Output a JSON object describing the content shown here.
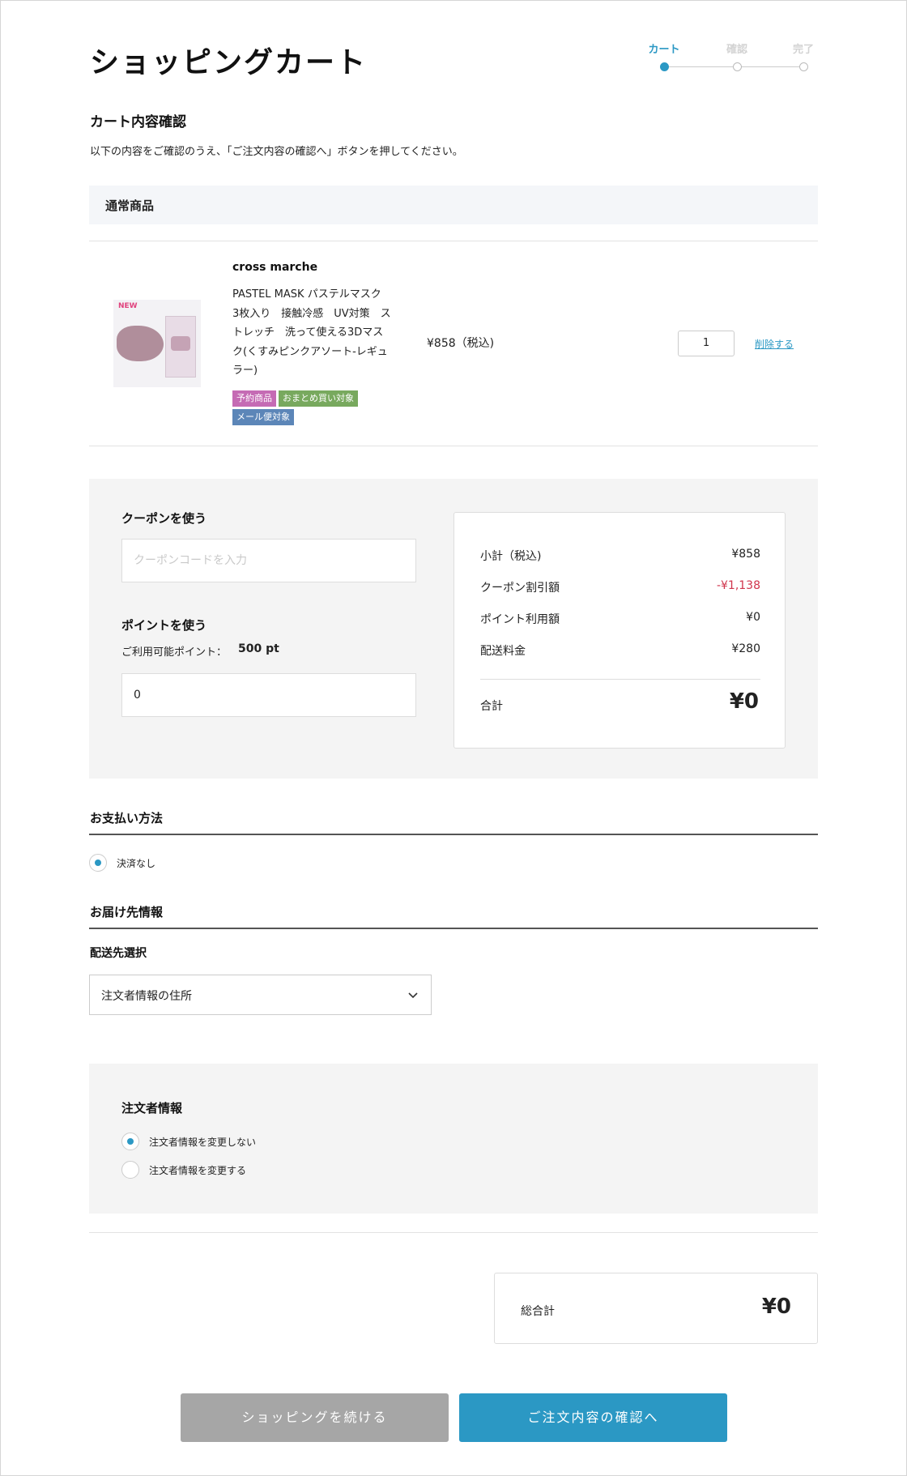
{
  "header": {
    "title": "ショッピングカート"
  },
  "steps": [
    {
      "label": "カート",
      "active": true
    },
    {
      "label": "確認",
      "active": false
    },
    {
      "label": "完了",
      "active": false
    }
  ],
  "cart_check": {
    "title": "カート内容確認",
    "description": "以下の内容をご確認のうえ、「ご注文内容の確認へ」ボタンを押してください。"
  },
  "normal_goods": {
    "label": "通常商品"
  },
  "item": {
    "image_badge": "NEW",
    "brand": "cross marche",
    "name": "PASTEL MASK パステルマスク 3枚入り 接触冷感 UV対策 ストレッチ 洗って使える3Dマスク(くすみピンクアソート-レギュラー)",
    "name_lines": [
      "PASTEL MASK パステルマスク",
      "3枚入り　接触冷感　UV対策　ス",
      "トレッチ　洗って使える3Dマス",
      "ク(くすみピンクアソート-レギュ",
      "ラー)"
    ],
    "tags": [
      {
        "label": "予約商品",
        "color": "#c56bb4"
      },
      {
        "label": "おまとめ買い対象",
        "color": "#78a95e"
      },
      {
        "label": "メール便対象",
        "color": "#5c86b8"
      }
    ],
    "price": "¥858（税込)",
    "quantity": "1",
    "delete_label": "削除する"
  },
  "coupon": {
    "title": "クーポンを使う",
    "placeholder": "クーポンコードを入力"
  },
  "points": {
    "title": "ポイントを使う",
    "available_label": "ご利用可能ポイント：",
    "available_value": "500 pt",
    "input_value": "0"
  },
  "summary": {
    "rows": [
      {
        "label": "小計（税込)",
        "value": "¥858"
      },
      {
        "label": "クーポン割引額",
        "value": "-¥1,138"
      },
      {
        "label": "ポイント利用額",
        "value": "¥0"
      },
      {
        "label": "配送料金",
        "value": "¥280"
      }
    ],
    "total_label": "合計",
    "total_value": "¥0",
    "negative_color": "#d0354c"
  },
  "payment": {
    "title": "お支払い方法",
    "option": "決済なし"
  },
  "delivery": {
    "title": "お届け先情報",
    "select_title": "配送先選択",
    "selected": "注文者情報の住所"
  },
  "orderer": {
    "title": "注文者情報",
    "options": [
      "注文者情報を変更しない",
      "注文者情報を変更する"
    ]
  },
  "grand_total": {
    "label": "総合計",
    "value": "¥0"
  },
  "buttons": {
    "continue": "ショッピングを続ける",
    "confirm": "ご注文内容の確認へ"
  },
  "colors": {
    "accent": "#2b98c4",
    "button_gray": "#a6a6a6"
  }
}
